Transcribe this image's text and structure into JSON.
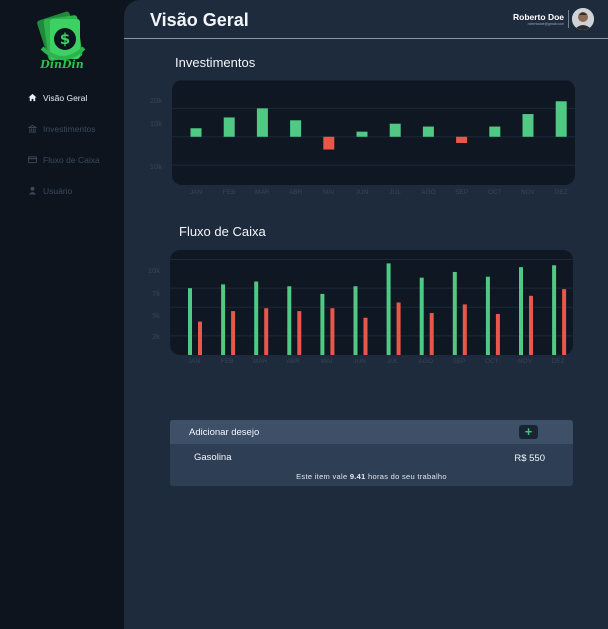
{
  "app": {
    "logo_text": "DinDin",
    "accent_color": "#2fbf4f"
  },
  "sidebar": {
    "items": [
      {
        "label": "Visão Geral",
        "icon": "home-icon",
        "active": true
      },
      {
        "label": "Investimentos",
        "icon": "bank-icon",
        "active": false
      },
      {
        "label": "Fluxo de Caixa",
        "icon": "card-icon",
        "active": false
      },
      {
        "label": "Usuário",
        "icon": "user-icon",
        "active": false
      }
    ]
  },
  "header": {
    "title": "Visão Geral",
    "user_name": "Roberto Doe",
    "user_email": "robertodoe@gmail.com"
  },
  "investimentos": {
    "title": "Investimentos",
    "y_ticks": [
      "20k",
      "10k",
      "10k"
    ],
    "positive_color": "#4fc983",
    "negative_color": "#e8574a"
  },
  "fluxo": {
    "title": "Fluxo de Caixa",
    "y_ticks": [
      "10k",
      "7k",
      "5k",
      "2k"
    ],
    "income_color": "#4fc983",
    "expense_color": "#e8574a"
  },
  "chart_data": [
    {
      "type": "bar",
      "title": "Investimentos",
      "categories": [
        "JAN",
        "FEB",
        "MAR",
        "ABR",
        "MAI",
        "JUN",
        "JUL",
        "AGO",
        "SEP",
        "OCT",
        "NOV",
        "DEZ"
      ],
      "values": [
        3000,
        6800,
        10000,
        5800,
        -4500,
        1800,
        4600,
        3600,
        -2200,
        3600,
        8000,
        12500
      ],
      "ylim": [
        -17000,
        20000
      ]
    },
    {
      "type": "bar",
      "title": "Fluxo de Caixa",
      "categories": [
        "JAN",
        "FEB",
        "MAR",
        "ABR",
        "MAI",
        "JUN",
        "JUL",
        "AGO",
        "SEP",
        "OCT",
        "NOV",
        "DEZ"
      ],
      "series": [
        {
          "values": [
            7000,
            7400,
            7700,
            7200,
            6400,
            7200,
            9600,
            8100,
            8700,
            8200,
            9200,
            9400
          ]
        },
        {
          "values": [
            3500,
            4600,
            4900,
            4600,
            4900,
            3900,
            5500,
            4400,
            5300,
            4300,
            6200,
            6900
          ]
        }
      ],
      "ylim": [
        0,
        11000
      ]
    }
  ],
  "wishlist": {
    "title": "Adicionar desejo",
    "add_label": "+",
    "item_name": "Gasolina",
    "item_price": "R$ 550",
    "note_prefix": "Este item vale ",
    "note_hours": "9.41",
    "note_suffix": " horas do seu trabalho"
  }
}
